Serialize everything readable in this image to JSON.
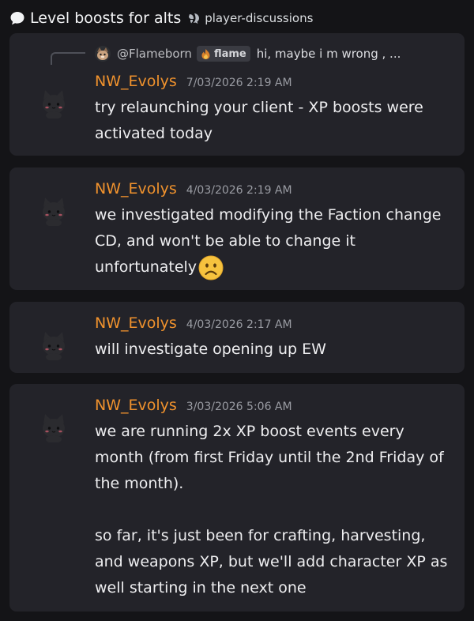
{
  "header": {
    "thread_icon": "speech-bubble-icon",
    "thread_title": "Level boosts for alts",
    "channel_icon": "thread-channel-icon",
    "channel_name": "player-discussions"
  },
  "messages": [
    {
      "reply": {
        "author": "@Flameborn",
        "tag": "flame",
        "text": "hi, maybe i m wrong , ..."
      },
      "author": "NW_Evolys",
      "timestamp": "7/03/2026 2:19 AM",
      "paragraphs": [
        "try relaunching your client - XP boosts were activated today"
      ]
    },
    {
      "author": "NW_Evolys",
      "timestamp": "4/03/2026 2:19 AM",
      "paragraphs": [
        "we investigated modifying the Faction change CD, and won't be able to change it unfortunately"
      ],
      "emoji": "frowning-face-emoji"
    },
    {
      "author": "NW_Evolys",
      "timestamp": "4/03/2026 2:17 AM",
      "paragraphs": [
        "will investigate opening up EW"
      ]
    },
    {
      "author": "NW_Evolys",
      "timestamp": "3/03/2026 5:06 AM",
      "paragraphs": [
        "we are running 2x XP boost events every month (from first Friday until the 2nd Friday of the month).",
        "so far, it's just been for crafting, harvesting, and weapons XP, but we'll add character XP as well starting in the next one"
      ]
    }
  ],
  "colors": {
    "background": "#141417",
    "card": "#232329",
    "author": "#f0922d",
    "timestamp": "#9a9ca3"
  }
}
